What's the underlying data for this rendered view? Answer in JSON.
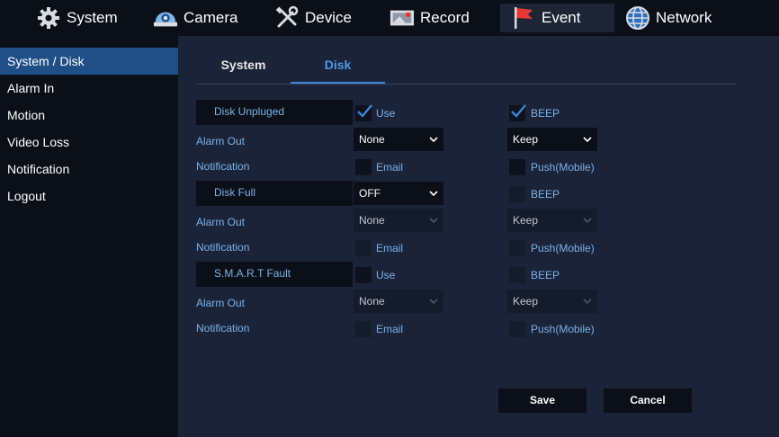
{
  "nav": {
    "system": "System",
    "camera": "Camera",
    "device": "Device",
    "record": "Record",
    "event": "Event",
    "network": "Network"
  },
  "sidebar": {
    "items": [
      "System / Disk",
      "Alarm In",
      "Motion",
      "Video Loss",
      "Notification",
      "Logout"
    ]
  },
  "tabs": {
    "system": "System",
    "disk": "Disk"
  },
  "sections": [
    {
      "header": "Disk Unpluged",
      "use_label": "Use",
      "use_checked": true,
      "beep_label": "BEEP",
      "beep_checked": true,
      "alarm_out_label": "Alarm Out",
      "alarm_out_value": "None",
      "action_value": "Keep",
      "notification_label": "Notification",
      "email_label": "Email",
      "push_label": "Push(Mobile)"
    },
    {
      "header": "Disk Full",
      "mode_value": "OFF",
      "beep_label": "BEEP",
      "alarm_out_label": "Alarm Out",
      "alarm_out_value": "None",
      "action_value": "Keep",
      "notification_label": "Notification",
      "email_label": "Email",
      "push_label": "Push(Mobile)"
    },
    {
      "header": "S.M.A.R.T Fault",
      "use_label": "Use",
      "beep_label": "BEEP",
      "alarm_out_label": "Alarm Out",
      "alarm_out_value": "None",
      "action_value": "Keep",
      "notification_label": "Notification",
      "email_label": "Email",
      "push_label": "Push(Mobile)"
    }
  ],
  "buttons": {
    "save": "Save",
    "cancel": "Cancel"
  },
  "icons": {
    "system": "gear-icon",
    "camera": "camera-icon",
    "device": "tools-icon",
    "record": "record-icon",
    "event": "flag-icon",
    "network": "globe-icon",
    "check": "checkmark-icon",
    "dropdown": "chevron-down-icon"
  },
  "colors": {
    "background": "#1a2338",
    "panel": "#0b0f17",
    "accent": "#3a86d6",
    "label": "#7cb2ea",
    "sidebar_active": "#1f4f86",
    "event_flag": "#e53935"
  }
}
